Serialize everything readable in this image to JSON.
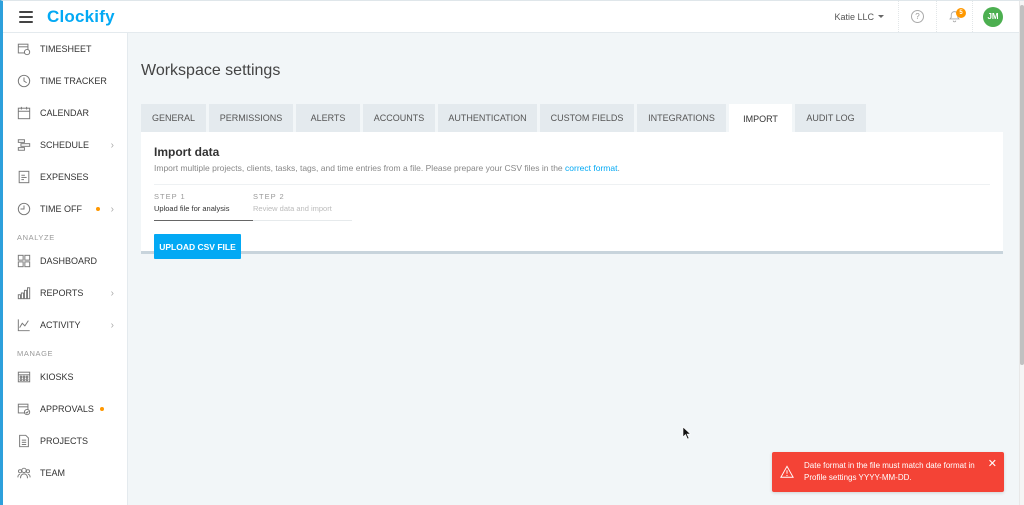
{
  "app": {
    "logo": "Clockify",
    "workspace": "Katie LLC",
    "help_icon": "?",
    "notification_count": "5",
    "avatar_initials": "JM",
    "colors": {
      "accent": "#03a9f4",
      "sidebar_border": "#2da0dc",
      "avatar": "#4caf50",
      "badge": "#ff9800",
      "toast": "#f44336"
    }
  },
  "sidebar": {
    "items": [
      {
        "label": "TIMESHEET",
        "icon": "timesheet-icon"
      },
      {
        "label": "TIME TRACKER",
        "icon": "clock-icon"
      },
      {
        "label": "CALENDAR",
        "icon": "calendar-icon"
      },
      {
        "label": "SCHEDULE",
        "icon": "schedule-icon",
        "chevron": true
      },
      {
        "label": "EXPENSES",
        "icon": "receipt-icon"
      },
      {
        "label": "TIME OFF",
        "icon": "time-off-icon",
        "dot": true,
        "chevron": true
      }
    ],
    "analyze_label": "ANALYZE",
    "analyze_items": [
      {
        "label": "DASHBOARD",
        "icon": "dashboard-icon"
      },
      {
        "label": "REPORTS",
        "icon": "reports-icon",
        "chevron": true
      },
      {
        "label": "ACTIVITY",
        "icon": "activity-icon",
        "chevron": true
      }
    ],
    "manage_label": "MANAGE",
    "manage_items": [
      {
        "label": "KIOSKS",
        "icon": "kiosk-icon"
      },
      {
        "label": "APPROVALS",
        "icon": "approvals-icon",
        "dot": true
      },
      {
        "label": "PROJECTS",
        "icon": "projects-icon"
      },
      {
        "label": "TEAM",
        "icon": "team-icon"
      }
    ]
  },
  "main": {
    "title": "Workspace settings",
    "tabs": [
      {
        "label": "GENERAL"
      },
      {
        "label": "PERMISSIONS"
      },
      {
        "label": "ALERTS"
      },
      {
        "label": "ACCOUNTS"
      },
      {
        "label": "AUTHENTICATION"
      },
      {
        "label": "CUSTOM FIELDS"
      },
      {
        "label": "INTEGRATIONS"
      },
      {
        "label": "IMPORT",
        "active": true
      },
      {
        "label": "AUDIT LOG"
      }
    ],
    "import": {
      "heading": "Import data",
      "description": "Import multiple projects, clients, tasks, tags, and time entries from a file. Please prepare your CSV files in the ",
      "link": "correct format",
      "link_suffix": ".",
      "steps": [
        {
          "num": "STEP 1",
          "desc": "Upload file for analysis"
        },
        {
          "num": "STEP 2",
          "desc": "Review data and import"
        }
      ],
      "upload_button": "UPLOAD CSV FILE"
    }
  },
  "toast": {
    "message": "Date format in the file must match date format in Profile settings YYYY-MM-DD.",
    "close": "✕"
  }
}
